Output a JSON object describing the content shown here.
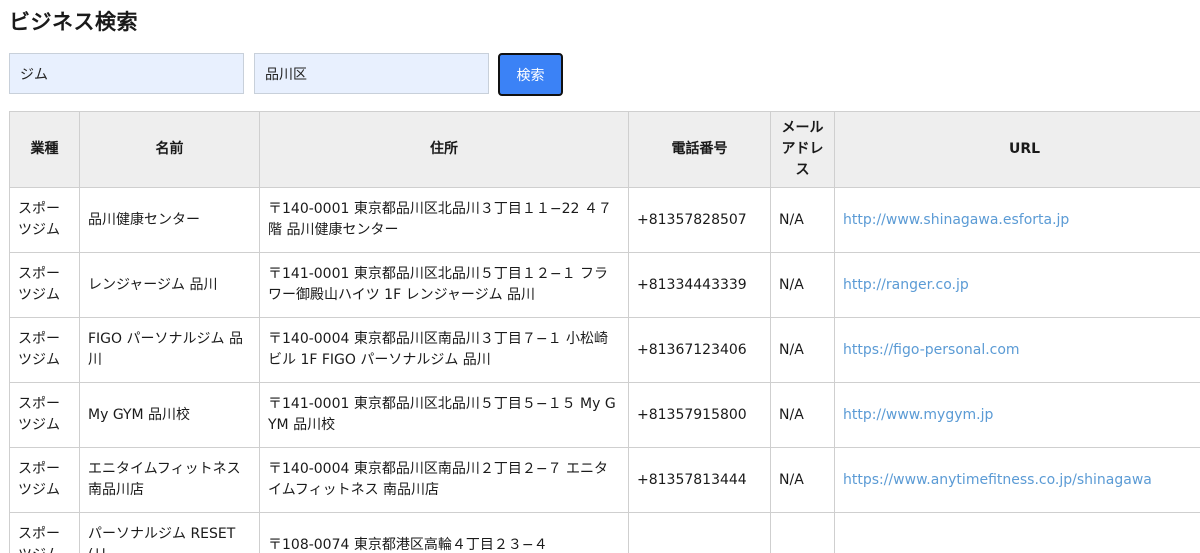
{
  "page": {
    "title": "ビジネス検索"
  },
  "search": {
    "category_value": "ジム",
    "location_value": "品川区",
    "button_label": "検索"
  },
  "table": {
    "headers": {
      "category": "業種",
      "name": "名前",
      "address": "住所",
      "phone": "電話番号",
      "email": "メールアドレス",
      "url": "URL"
    },
    "rows": [
      {
        "category": "スポーツジム",
        "name": "品川健康センター",
        "address": "〒140-0001 東京都品川区北品川３丁目１１−22 ４７階 品川健康センター",
        "phone": "+81357828507",
        "email": "N/A",
        "url": "http://www.shinagawa.esforta.jp"
      },
      {
        "category": "スポーツジム",
        "name": "レンジャージム 品川",
        "address": "〒141-0001 東京都品川区北品川５丁目１２−１ フラワー御殿山ハイツ 1F レンジャージム 品川",
        "phone": "+81334443339",
        "email": "N/A",
        "url": "http://ranger.co.jp"
      },
      {
        "category": "スポーツジム",
        "name": "FIGO パーソナルジム 品川",
        "address": "〒140-0004 東京都品川区南品川３丁目７−１ 小松崎ビル 1F FIGO パーソナルジム 品川",
        "phone": "+81367123406",
        "email": "N/A",
        "url": "https://figo-personal.com"
      },
      {
        "category": "スポーツジム",
        "name": "My GYM 品川校",
        "address": "〒141-0001 東京都品川区北品川５丁目５−１５ My GYM 品川校",
        "phone": "+81357915800",
        "email": "N/A",
        "url": "http://www.mygym.jp"
      },
      {
        "category": "スポーツジム",
        "name": "エニタイムフィットネス 南品川店",
        "address": "〒140-0004 東京都品川区南品川２丁目２−７ エニタイムフィットネス 南品川店",
        "phone": "+81357813444",
        "email": "N/A",
        "url": "https://www.anytimefitness.co.jp/shinagawa"
      },
      {
        "category": "スポーツジム",
        "name": "パーソナルジム RESET(リ",
        "address": "〒108-0074 東京都港区高輪４丁目２３−４",
        "phone": "",
        "email": "",
        "url": ""
      }
    ]
  }
}
